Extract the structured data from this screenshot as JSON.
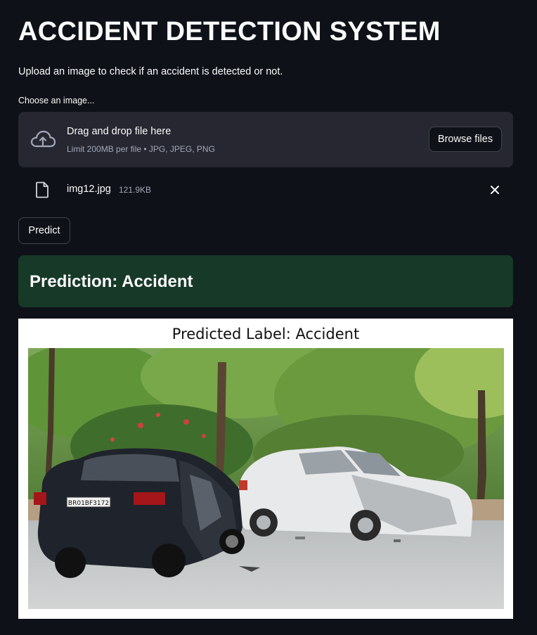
{
  "page": {
    "title": "ACCIDENT DETECTION SYSTEM",
    "subtitle": "Upload an image to check if an accident is detected or not."
  },
  "uploader": {
    "label": "Choose an image...",
    "drop_text": "Drag and drop file here",
    "limit_text": "Limit 200MB per file • JPG, JPEG, PNG",
    "browse_label": "Browse files",
    "icon": "cloud-upload-icon"
  },
  "uploaded_file": {
    "name": "img12.jpg",
    "size": "121.9KB",
    "icon": "file-icon",
    "remove_icon": "close-icon"
  },
  "actions": {
    "predict_label": "Predict"
  },
  "result": {
    "text": "Prediction: Accident"
  },
  "figure": {
    "title": "Predicted Label: Accident",
    "plate_text": "BR01BF3172"
  },
  "colors": {
    "background": "#0e1117",
    "dropzone": "#262730",
    "success": "#173928",
    "text": "#fafafa",
    "muted": "#a3a8b8"
  }
}
